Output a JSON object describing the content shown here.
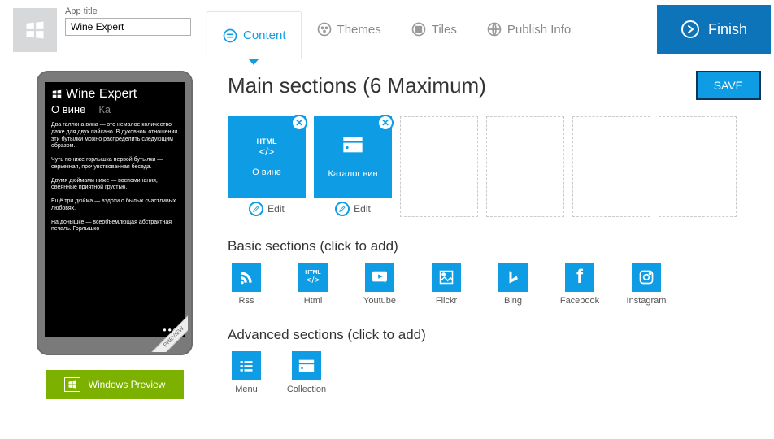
{
  "app_title_field": {
    "label": "App title",
    "value": "Wine Expert"
  },
  "tabs": {
    "content": "Content",
    "themes": "Themes",
    "tiles": "Tiles",
    "publish": "Publish Info"
  },
  "finish_label": "Finish",
  "phone_preview": {
    "app_name": "Wine Expert",
    "pivot_active": "О вине",
    "pivot_next": "Ка",
    "paras": [
      "Два галлона вина — это немалое количество даже для двух пайсано. В духовном отношении эти бутылки можно распределить следующим образом.",
      "Чуть пониже горлышка первой бутылки — серьезная, прочувствованная беседа.",
      "Двумя дюймами ниже — воспоминания, овеянные приятной грустью.",
      "Ещё три дюйма — вздохи о былых счастливых любовях.",
      "На донышке — всеобъемлющая абстрактная печаль. Горлышко"
    ],
    "ribbon": "PREVIEW"
  },
  "windows_preview_label": "Windows Preview",
  "main": {
    "title": "Main sections (6 Maximum)",
    "save_label": "SAVE",
    "sections": [
      {
        "kind": "html",
        "label": "О вине",
        "edit": "Edit"
      },
      {
        "kind": "collection",
        "label": "Каталог вин",
        "edit": "Edit"
      }
    ],
    "max_slots": 6
  },
  "basic": {
    "title": "Basic sections (click to add)",
    "items": [
      {
        "id": "rss",
        "label": "Rss"
      },
      {
        "id": "html",
        "label": "Html"
      },
      {
        "id": "youtube",
        "label": "Youtube"
      },
      {
        "id": "flickr",
        "label": "Flickr"
      },
      {
        "id": "bing",
        "label": "Bing"
      },
      {
        "id": "facebook",
        "label": "Facebook"
      },
      {
        "id": "instagram",
        "label": "Instagram"
      }
    ]
  },
  "advanced": {
    "title": "Advanced sections (click to add)",
    "items": [
      {
        "id": "menu",
        "label": "Menu"
      },
      {
        "id": "collection",
        "label": "Collection"
      }
    ]
  }
}
